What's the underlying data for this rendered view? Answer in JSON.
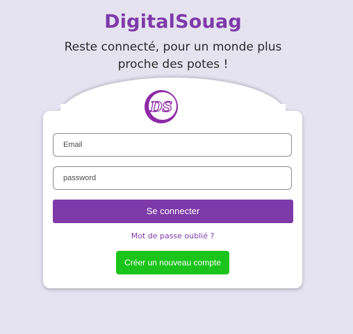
{
  "header": {
    "brand": "DigitalSouag",
    "tagline": "Reste connecté, pour un monde plus proche des potes !"
  },
  "logo": {
    "icon": "ds-monogram-logo",
    "color": "#8e2aa6"
  },
  "login_form": {
    "email_placeholder": "Email",
    "password_placeholder": "password",
    "submit_label": "Se connecter",
    "forgot_password_label": "Mot de passe oublié ?",
    "create_account_label": "Créer un nouveau compte"
  },
  "colors": {
    "accent": "#7e3aa8",
    "create_button": "#1ac41a",
    "background": "#e6e3f1"
  }
}
